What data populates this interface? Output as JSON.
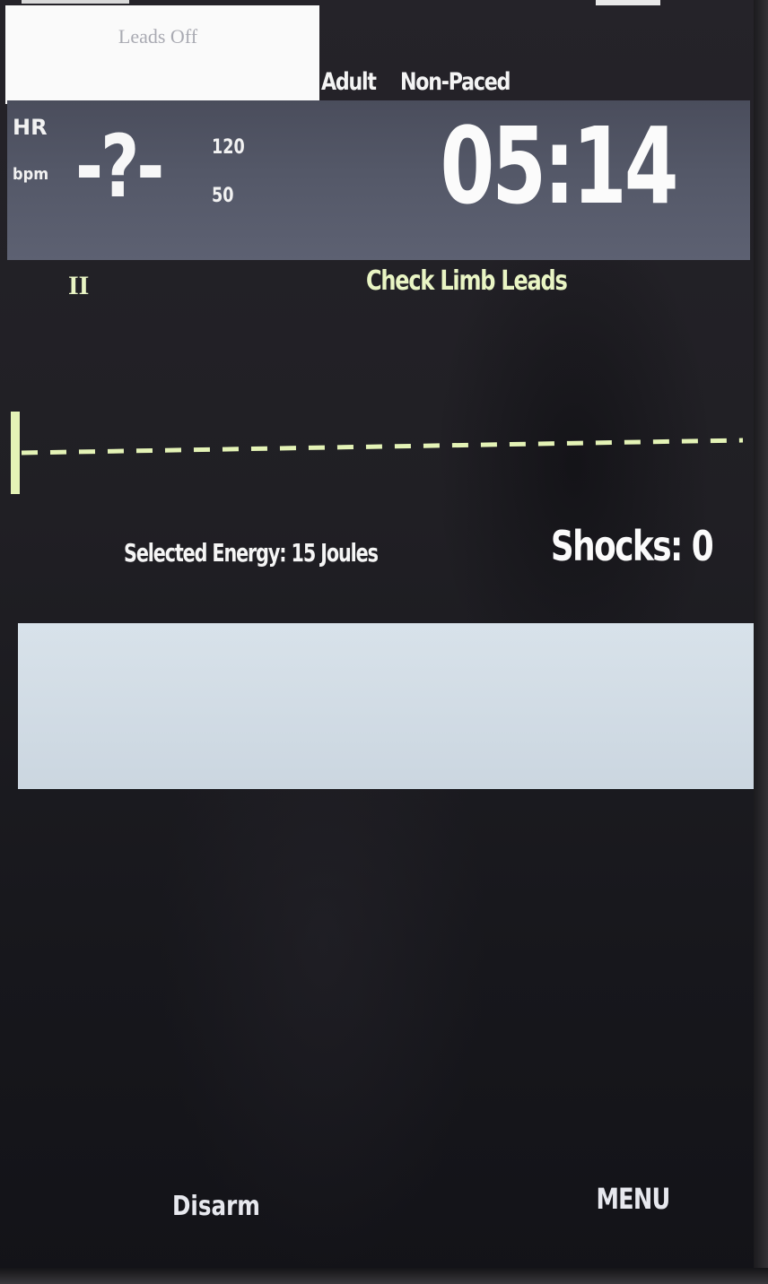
{
  "header": {
    "leads_off_text": "Leads Off",
    "patient_type": "Adult",
    "pacing_mode": "Non-Paced"
  },
  "vitals": {
    "hr_label": "HR",
    "hr_unit": "bpm",
    "hr_value": "-?-",
    "alarm_high": "120",
    "alarm_low": "50",
    "elapsed_time": "05:14"
  },
  "ecg": {
    "lead": "II",
    "message": "Check Limb Leads",
    "trace_color": "#e4f3b6"
  },
  "defib": {
    "energy_text": "Selected Energy: 15 Joules",
    "shocks_text": "Shocks: 0"
  },
  "softkeys": {
    "left_label": "Disarm",
    "right_label": "MENU"
  },
  "colors": {
    "hr_panel": "#545868",
    "message_bar": "#d0dae3",
    "ecg_text": "#e9f5c4"
  }
}
